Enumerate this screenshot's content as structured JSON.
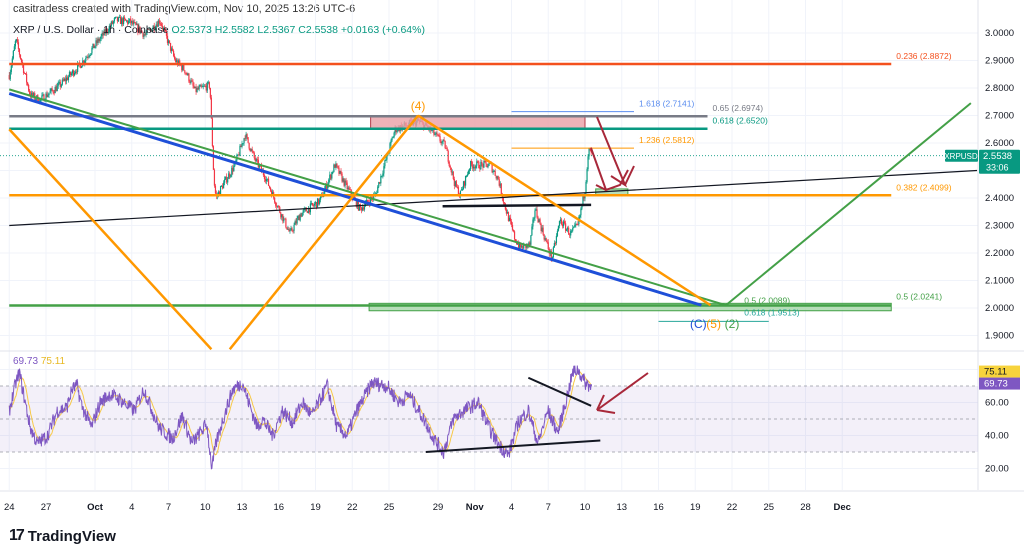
{
  "header": {
    "title": "casitradess created with TradingView.com, Nov 10, 2025 13:26 UTC-6",
    "symbol": "XRP / U.S. Dollar · 1h · Coinbase",
    "open": "O2.5373",
    "high": "H2.5582",
    "low": "L2.5367",
    "close": "C2.5538",
    "change": "+0.0163 (+0.64%)"
  },
  "footer": {
    "logo_mark": "17",
    "brand": "TradingView"
  },
  "colors": {
    "up": "#089981",
    "down": "#f23645",
    "rsi": "#7e57c2",
    "rsi_ma": "#f7c948",
    "orange": "#ff9800",
    "fib_red": "#f4511e",
    "green": "#43a047",
    "blue": "#1e4fd8",
    "arrow": "#a8283a"
  },
  "chart_data": [
    {
      "type": "candlestick",
      "title": "",
      "timeframe": "1h",
      "y_scale": "price",
      "ylim": [
        1.85,
        3.05
      ],
      "y_ticks": [
        "3.0000",
        "2.9000",
        "2.8000",
        "2.7000",
        "2.6000",
        "2.5000",
        "2.4000",
        "2.3000",
        "2.2000",
        "2.1000",
        "2.0000",
        "1.9000"
      ],
      "x_ticks": [
        {
          "label": "24",
          "date": "2025-09-24"
        },
        {
          "label": "27",
          "date": "2025-09-27"
        },
        {
          "label": "Oct",
          "date": "2025-10-01"
        },
        {
          "label": "4",
          "date": "2025-10-04"
        },
        {
          "label": "7",
          "date": "2025-10-07"
        },
        {
          "label": "10",
          "date": "2025-10-10"
        },
        {
          "label": "13",
          "date": "2025-10-13"
        },
        {
          "label": "16",
          "date": "2025-10-16"
        },
        {
          "label": "19",
          "date": "2025-10-19"
        },
        {
          "label": "22",
          "date": "2025-10-22"
        },
        {
          "label": "25",
          "date": "2025-10-25"
        },
        {
          "label": "29",
          "date": "2025-10-29"
        },
        {
          "label": "Nov",
          "date": "2025-11-01"
        },
        {
          "label": "4",
          "date": "2025-11-04"
        },
        {
          "label": "7",
          "date": "2025-11-07"
        },
        {
          "label": "10",
          "date": "2025-11-10"
        },
        {
          "label": "13",
          "date": "2025-11-13"
        },
        {
          "label": "16",
          "date": "2025-11-16"
        },
        {
          "label": "19",
          "date": "2025-11-19"
        },
        {
          "label": "22",
          "date": "2025-11-22"
        },
        {
          "label": "25",
          "date": "2025-11-25"
        },
        {
          "label": "28",
          "date": "2025-11-28"
        },
        {
          "label": "Dec",
          "date": "2025-12-01"
        }
      ],
      "price_path": [
        {
          "t": "2025-09-24T00:00",
          "p": 2.847
        },
        {
          "t": "2025-09-24T13:00",
          "p": 2.975
        },
        {
          "t": "2025-09-25T17:00",
          "p": 2.775
        },
        {
          "t": "2025-09-26T12:00",
          "p": 2.756
        },
        {
          "t": "2025-09-28T03:00",
          "p": 2.81
        },
        {
          "t": "2025-09-29T19:00",
          "p": 2.884
        },
        {
          "t": "2025-10-01T00:00",
          "p": 2.956
        },
        {
          "t": "2025-10-02T15:00",
          "p": 3.047
        },
        {
          "t": "2025-10-03T21:00",
          "p": 3.04
        },
        {
          "t": "2025-10-05T02:00",
          "p": 2.993
        },
        {
          "t": "2025-10-06T07:00",
          "p": 3.047
        },
        {
          "t": "2025-10-07T13:00",
          "p": 2.9
        },
        {
          "t": "2025-10-08T08:00",
          "p": 2.865
        },
        {
          "t": "2025-10-09T04:00",
          "p": 2.79
        },
        {
          "t": "2025-10-10T09:00",
          "p": 2.81
        },
        {
          "t": "2025-10-10T17:00",
          "p": 2.465
        },
        {
          "t": "2025-10-10T21:00",
          "p": 2.4,
          "low": 1.58
        },
        {
          "t": "2025-10-11T05:00",
          "p": 2.43
        },
        {
          "t": "2025-10-12T10:00",
          "p": 2.52
        },
        {
          "t": "2025-10-13T06:00",
          "p": 2.63
        },
        {
          "t": "2025-10-14T01:00",
          "p": 2.54
        },
        {
          "t": "2025-10-14T21:00",
          "p": 2.48
        },
        {
          "t": "2025-10-15T17:00",
          "p": 2.39
        },
        {
          "t": "2025-10-16T22:00",
          "p": 2.27
        },
        {
          "t": "2025-10-17T18:00",
          "p": 2.34
        },
        {
          "t": "2025-10-19T09:00",
          "p": 2.39
        },
        {
          "t": "2025-10-20T14:00",
          "p": 2.52
        },
        {
          "t": "2025-10-21T10:00",
          "p": 2.45
        },
        {
          "t": "2025-10-22T15:00",
          "p": 2.36
        },
        {
          "t": "2025-10-23T21:00",
          "p": 2.41
        },
        {
          "t": "2025-10-25T12:00",
          "p": 2.65
        },
        {
          "t": "2025-10-27T09:00",
          "p": 2.68
        },
        {
          "t": "2025-10-28T08:00",
          "p": 2.65
        },
        {
          "t": "2025-10-29T14:00",
          "p": 2.59
        },
        {
          "t": "2025-10-30T09:00",
          "p": 2.45
        },
        {
          "t": "2025-10-30T19:00",
          "p": 2.41
        },
        {
          "t": "2025-10-31T15:00",
          "p": 2.52
        },
        {
          "t": "2025-11-02T06:00",
          "p": 2.52
        },
        {
          "t": "2025-11-02T22:00",
          "p": 2.47
        },
        {
          "t": "2025-11-03T11:00",
          "p": 2.37
        },
        {
          "t": "2025-11-04T07:00",
          "p": 2.25
        },
        {
          "t": "2025-11-04T17:00",
          "p": 2.22,
          "low": 2.07
        },
        {
          "t": "2025-11-05T12:00",
          "p": 2.23
        },
        {
          "t": "2025-11-05T22:00",
          "p": 2.36
        },
        {
          "t": "2025-11-06T18:00",
          "p": 2.25
        },
        {
          "t": "2025-11-07T07:00",
          "p": 2.18
        },
        {
          "t": "2025-11-07T23:00",
          "p": 2.32
        },
        {
          "t": "2025-11-08T19:00",
          "p": 2.27
        },
        {
          "t": "2025-11-09T10:00",
          "p": 2.3
        },
        {
          "t": "2025-11-10T00:00",
          "p": 2.43
        },
        {
          "t": "2025-11-10T06:00",
          "p": 2.56
        },
        {
          "t": "2025-11-10T09:00",
          "p": 2.575
        },
        {
          "t": "2025-11-10T13:00",
          "p": 2.5538
        }
      ],
      "last_price": {
        "symbol": "XRPUSD",
        "value": "2.5538",
        "countdown": "33:06"
      },
      "drawings": {
        "fib_levels": [
          {
            "label": "0.236 (2.8872)",
            "price": 2.8872,
            "from": "2025-09-24",
            "to": "2025-12-05",
            "color": "#f4511e",
            "width": 2.5
          },
          {
            "label": "0.65 (2.6974)",
            "price": 2.6974,
            "from": "2025-09-24",
            "to": "2025-11-20",
            "color": "#787b86",
            "width": 2.5
          },
          {
            "label": "0.618 (2.6520)",
            "price": 2.652,
            "from": "2025-09-24",
            "to": "2025-11-20",
            "color": "#089981",
            "width": 2.5
          },
          {
            "label": "1.618 (2.7141)",
            "price": 2.7141,
            "from": "2025-11-04",
            "to": "2025-11-14",
            "color": "#5b8def",
            "width": 1
          },
          {
            "label": "1.236 (2.5812)",
            "price": 2.5812,
            "from": "2025-11-04",
            "to": "2025-11-14",
            "color": "#ff9800",
            "width": 1
          },
          {
            "label": "0.382 (2.4099)",
            "price": 2.4099,
            "from": "2025-09-24",
            "to": "2025-12-05",
            "color": "#ff9800",
            "width": 2.5
          },
          {
            "label": "0.5 (2.0241)",
            "price": 2.0089,
            "from": "2025-09-24",
            "to": "2025-12-05",
            "color": "#43a047",
            "width": 2.5
          },
          {
            "label": "0.5 (2.0089)",
            "price": 2.0089,
            "from": "2025-11-22",
            "to": "2025-11-22",
            "color": "#43a047",
            "width": 0
          },
          {
            "label": "0.618 (1.9513)",
            "price": 1.9513,
            "from": "2025-11-16",
            "to": "2025-11-25",
            "color": "#26a69a",
            "width": 1
          }
        ],
        "zones": [
          {
            "name": "resistance-zone",
            "from": "2025-10-23T12:00",
            "to": "2025-11-10T00:00",
            "top": 2.7,
            "bottom": 2.652,
            "color": "#e8a0a6",
            "border": "#b23a48"
          },
          {
            "name": "support-zone-small",
            "from": "2025-11-10T21:00",
            "to": "2025-11-13T12:00",
            "top": 2.433,
            "bottom": 2.41,
            "color": "#a5d6a7",
            "border": "#43a047"
          },
          {
            "name": "target-zone",
            "from": "2025-10-23T09:00",
            "to": "2025-12-05",
            "top": 2.017,
            "bottom": 1.99,
            "color": "#a5d6a7",
            "border": "#43a047"
          }
        ],
        "trendlines": [
          {
            "name": "black-trendline",
            "a": [
              "2025-09-24",
              2.3
            ],
            "b": [
              "2025-12-12",
              2.5
            ],
            "color": "#131722",
            "width": 1.2
          },
          {
            "name": "black-support-segment",
            "a": [
              "2025-10-29T09:00",
              2.37
            ],
            "b": [
              "2025-11-10T12:00",
              2.375
            ],
            "color": "#131722",
            "width": 2.5
          },
          {
            "name": "blue-channel-line",
            "a": [
              "2025-09-24",
              2.78
            ],
            "b": [
              "2025-11-19T12:00",
              2.01
            ],
            "color": "#1e4fd8",
            "width": 3
          },
          {
            "name": "green-channel-line",
            "a": [
              "2025-09-24",
              2.795
            ],
            "b": [
              "2025-11-21T12:00",
              2.01
            ],
            "color": "#43a047",
            "width": 2
          },
          {
            "name": "green-projection-up",
            "a": [
              "2025-11-21T12:00",
              2.01
            ],
            "b": [
              "2025-12-11T12:00",
              2.745
            ],
            "color": "#43a047",
            "width": 2
          },
          {
            "name": "orange-leg-down",
            "a": [
              "2025-09-24",
              2.65
            ],
            "b": [
              "2025-10-10T12:00",
              1.85
            ],
            "color": "#ff9800",
            "width": 2.5
          },
          {
            "name": "orange-leg-up",
            "a": [
              "2025-10-12T00:00",
              1.85
            ],
            "b": [
              "2025-10-27T09:00",
              2.7
            ],
            "color": "#ff9800",
            "width": 2.5
          },
          {
            "name": "orange-leg-down-2",
            "a": [
              "2025-10-27T09:00",
              2.7
            ],
            "b": [
              "2025-11-20T06:00",
              2.01
            ],
            "color": "#ff9800",
            "width": 2.5
          }
        ],
        "wave_labels": [
          {
            "text": "(4)",
            "t": "2025-10-27T09:00",
            "price": 2.75,
            "color": "#ff9800"
          },
          {
            "text": "(C)",
            "t": "2025-11-19T06:00",
            "price": 1.95,
            "color": "#1e4fd8"
          },
          {
            "text": "(5)",
            "t": "2025-11-20T12:00",
            "price": 1.95,
            "color": "#ff9800"
          },
          {
            "text": "(2)",
            "t": "2025-11-22T00:00",
            "price": 1.95,
            "color": "#43a047"
          }
        ]
      }
    },
    {
      "type": "line",
      "title": "",
      "ylim": [
        10,
        90
      ],
      "y_ticks": [
        "80.00",
        "60.00",
        "40.00",
        "20.00"
      ],
      "band": [
        30,
        70
      ],
      "midline": 50,
      "series": [
        {
          "values_label": "69.73",
          "color": "#7e57c2"
        },
        {
          "values_label": "75.11",
          "color": "#f7c948"
        }
      ],
      "rsi_path": [
        {
          "t": "2025-09-24T00:00",
          "v": 55
        },
        {
          "t": "2025-09-24T13:00",
          "v": 72
        },
        {
          "t": "2025-09-24T20:00",
          "v": 78
        },
        {
          "t": "2025-09-25T04:00",
          "v": 65
        },
        {
          "t": "2025-09-25T17:00",
          "v": 45
        },
        {
          "t": "2025-09-26T07:00",
          "v": 35
        },
        {
          "t": "2025-09-27T03:00",
          "v": 40
        },
        {
          "t": "2025-09-27T22:00",
          "v": 55
        },
        {
          "t": "2025-09-28T17:00",
          "v": 57
        },
        {
          "t": "2025-09-29T03:00",
          "v": 68
        },
        {
          "t": "2025-09-29T13:00",
          "v": 70
        },
        {
          "t": "2025-09-29T22:00",
          "v": 58
        },
        {
          "t": "2025-09-30T17:00",
          "v": 45
        },
        {
          "t": "2025-10-01T10:00",
          "v": 60
        },
        {
          "t": "2025-10-02T05:00",
          "v": 65
        },
        {
          "t": "2025-10-03T00:00",
          "v": 62
        },
        {
          "t": "2025-10-04T05:00",
          "v": 55
        },
        {
          "t": "2025-10-05T00:00",
          "v": 68
        },
        {
          "t": "2025-10-06T05:00",
          "v": 45
        },
        {
          "t": "2025-10-07T08:00",
          "v": 38
        },
        {
          "t": "2025-10-08T03:00",
          "v": 52
        },
        {
          "t": "2025-10-08T22:00",
          "v": 35
        },
        {
          "t": "2025-10-10T03:00",
          "v": 47
        },
        {
          "t": "2025-10-10T13:00",
          "v": 20
        },
        {
          "t": "2025-10-10T21:00",
          "v": 35
        },
        {
          "t": "2025-10-11T11:00",
          "v": 50
        },
        {
          "t": "2025-10-12T06:00",
          "v": 68
        },
        {
          "t": "2025-10-13T01:00",
          "v": 72
        },
        {
          "t": "2025-10-13T11:00",
          "v": 62
        },
        {
          "t": "2025-10-14T06:00",
          "v": 45
        },
        {
          "t": "2025-10-14T16:00",
          "v": 50
        },
        {
          "t": "2025-10-15T12:00",
          "v": 40
        },
        {
          "t": "2025-10-16T07:00",
          "v": 55
        },
        {
          "t": "2025-10-17T03:00",
          "v": 48
        },
        {
          "t": "2025-10-17T22:00",
          "v": 60
        },
        {
          "t": "2025-10-18T17:00",
          "v": 52
        },
        {
          "t": "2025-10-19T23:00",
          "v": 70
        },
        {
          "t": "2025-10-20T18:00",
          "v": 45
        },
        {
          "t": "2025-10-21T14:00",
          "v": 40
        },
        {
          "t": "2025-10-22T09:00",
          "v": 55
        },
        {
          "t": "2025-10-23T15:00",
          "v": 72
        },
        {
          "t": "2025-10-24T20:00",
          "v": 70
        },
        {
          "t": "2025-10-25T20:00",
          "v": 60
        },
        {
          "t": "2025-10-26T15:00",
          "v": 65
        },
        {
          "t": "2025-10-27T20:00",
          "v": 50
        },
        {
          "t": "2025-10-28T16:00",
          "v": 38
        },
        {
          "t": "2025-10-29T11:00",
          "v": 30
        },
        {
          "t": "2025-10-30T06:00",
          "v": 50
        },
        {
          "t": "2025-10-31T02:00",
          "v": 55
        },
        {
          "t": "2025-11-01T07:00",
          "v": 60
        },
        {
          "t": "2025-11-02T03:00",
          "v": 45
        },
        {
          "t": "2025-11-02T22:00",
          "v": 35
        },
        {
          "t": "2025-11-03T18:00",
          "v": 28
        },
        {
          "t": "2025-11-04T13:00",
          "v": 48
        },
        {
          "t": "2025-11-05T09:00",
          "v": 55
        },
        {
          "t": "2025-11-06T04:00",
          "v": 35
        },
        {
          "t": "2025-11-06T23:00",
          "v": 55
        },
        {
          "t": "2025-11-07T19:00",
          "v": 42
        },
        {
          "t": "2025-11-08T10:00",
          "v": 60
        },
        {
          "t": "2025-11-09T00:00",
          "v": 78
        },
        {
          "t": "2025-11-09T10:00",
          "v": 80
        },
        {
          "t": "2025-11-10T00:00",
          "v": 72
        },
        {
          "t": "2025-11-10T13:00",
          "v": 69.73
        }
      ],
      "trendlines": [
        {
          "name": "rsi-resistance-line",
          "a": [
            "2025-11-05T09:00",
            75
          ],
          "b": [
            "2025-11-10T12:00",
            58
          ],
          "color": "#131722",
          "width": 2
        },
        {
          "name": "rsi-support-line",
          "a": [
            "2025-10-28T00:00",
            30
          ],
          "b": [
            "2025-11-11T06:00",
            37
          ],
          "color": "#131722",
          "width": 2
        }
      ]
    }
  ]
}
